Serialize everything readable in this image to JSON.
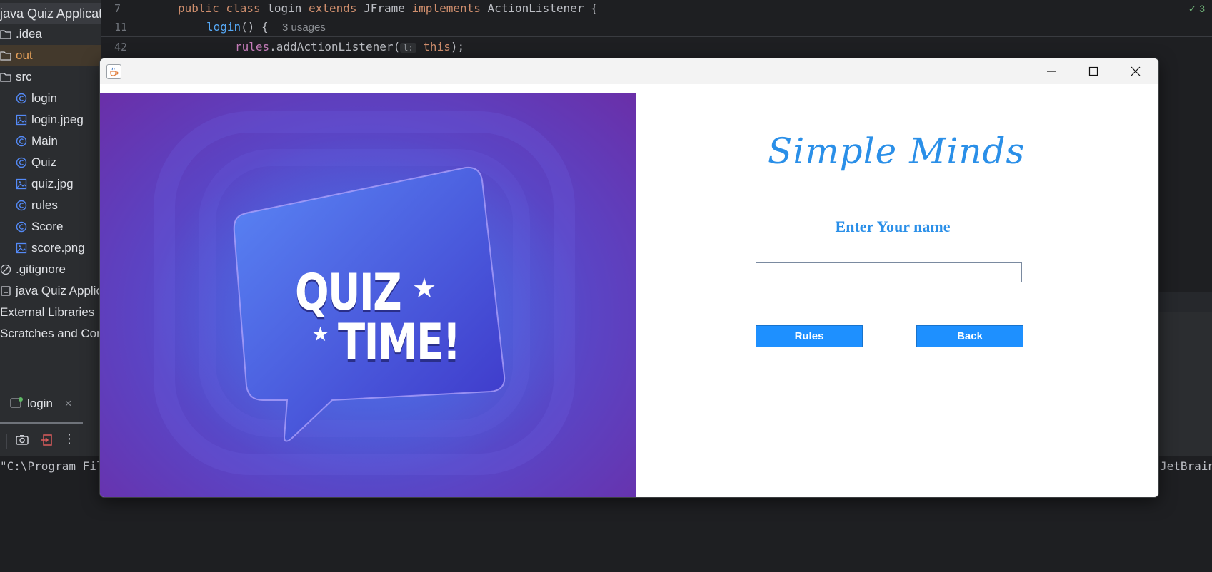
{
  "ide": {
    "project_title": "java Quiz Application",
    "tree": [
      {
        "label": ".idea",
        "icon": "folder-icon"
      },
      {
        "label": "out",
        "icon": "folder-icon"
      },
      {
        "label": "src",
        "icon": "folder-icon"
      },
      {
        "label": "login",
        "icon": "class-icon"
      },
      {
        "label": "login.jpeg",
        "icon": "image-file-icon"
      },
      {
        "label": "Main",
        "icon": "class-icon"
      },
      {
        "label": "Quiz",
        "icon": "class-icon"
      },
      {
        "label": "quiz.jpg",
        "icon": "image-file-icon"
      },
      {
        "label": "rules",
        "icon": "class-icon"
      },
      {
        "label": "Score",
        "icon": "class-icon"
      },
      {
        "label": "score.png",
        "icon": "image-file-icon"
      },
      {
        "label": ".gitignore",
        "icon": "ignore-file-icon"
      },
      {
        "label": "java Quiz Application",
        "icon": "module-file-icon"
      },
      {
        "label": "External Libraries",
        "icon": ""
      },
      {
        "label": "Scratches and Consoles",
        "icon": ""
      }
    ],
    "code": {
      "line_numbers": [
        "7",
        "11",
        "42"
      ],
      "l1": {
        "kw1": "public class ",
        "name": "login ",
        "kw2": "extends ",
        "parent": "JFrame ",
        "kw3": "implements ",
        "iface": "ActionListener {"
      },
      "l2": {
        "fn": "login",
        "rest": "() {",
        "hint": "3 usages"
      },
      "l3": {
        "field": "rules",
        "call": ".addActionListener(",
        "param_hint": "l:",
        "kw": "this",
        "end": ");"
      }
    },
    "inspection_count": "3",
    "run_tab_label": "login",
    "console_left": "\"C:\\Program Fil",
    "console_right": "JetBrain"
  },
  "java_window": {
    "image_text_line1": "QUIZ",
    "image_text_line2": "TIME!",
    "app_title": "Simple Minds",
    "name_label": "Enter Your name",
    "name_value": "",
    "rules_button": "Rules",
    "back_button": "Back"
  },
  "colors": {
    "accent": "#1e90ff",
    "title_text": "#2a8fe8",
    "ide_background": "#1e1f22"
  }
}
